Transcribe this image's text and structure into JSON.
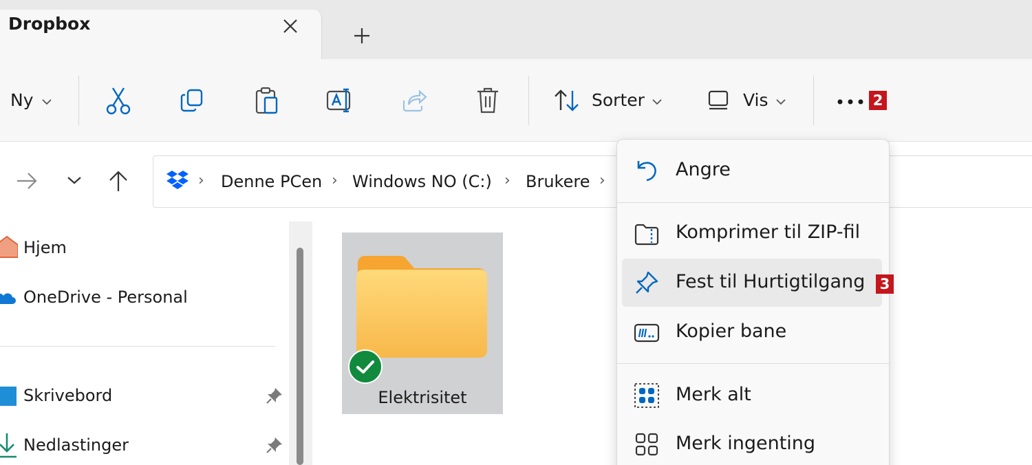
{
  "tab": {
    "title": "Dropbox"
  },
  "toolbar": {
    "new_label": "Ny",
    "sort_label": "Sorter",
    "view_label": "Vis",
    "more_badge": "2"
  },
  "address": {
    "crumbs": [
      "Denne PCen",
      "Windows NO (C:)",
      "Brukere"
    ]
  },
  "sidebar": {
    "items": [
      {
        "label": "Hjem"
      },
      {
        "label": "OneDrive - Personal"
      },
      {
        "label": "Skrivebord"
      },
      {
        "label": "Nedlastinger"
      }
    ]
  },
  "content": {
    "folder": {
      "name": "Elektrisitet"
    }
  },
  "menu": {
    "items": [
      {
        "label": "Angre"
      },
      {
        "label": "Komprimer til ZIP-fil"
      },
      {
        "label": "Fest til Hurtigtilgang",
        "badge": "3"
      },
      {
        "label": "Kopier bane"
      },
      {
        "label": "Merk alt"
      },
      {
        "label": "Merk ingenting"
      }
    ]
  },
  "colors": {
    "accent": "#0067c0",
    "badge": "#c4161c",
    "folder": "#f8c255",
    "sync_ok": "#118a3e"
  }
}
